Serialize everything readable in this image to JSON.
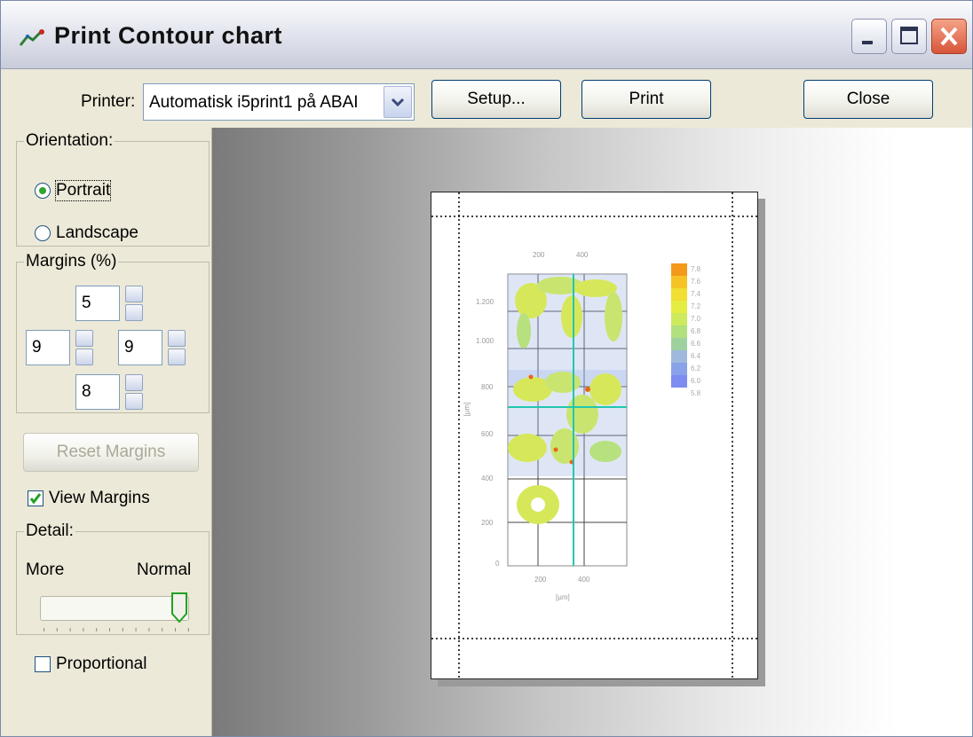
{
  "window": {
    "title": "Print Contour chart"
  },
  "toolbar": {
    "printer_label": "Printer:",
    "printer_value": "Automatisk i5print1 på ABAI",
    "setup_label": "Setup...",
    "print_label": "Print",
    "close_label": "Close"
  },
  "orientation": {
    "legend": "Orientation:",
    "portrait": "Portrait",
    "landscape": "Landscape",
    "selected": "portrait"
  },
  "margins": {
    "legend": "Margins (%)",
    "top": "5",
    "left": "9",
    "right": "9",
    "bottom": "8"
  },
  "reset_margins_label": "Reset Margins",
  "view_margins": {
    "label": "View Margins",
    "checked": true
  },
  "detail": {
    "legend": "Detail:",
    "more_label": "More",
    "normal_label": "Normal"
  },
  "proportional": {
    "label": "Proportional",
    "checked": false
  },
  "preview": {
    "x_ticks": [
      "200",
      "400"
    ],
    "y_ticks": [
      "1.200",
      "1.000",
      "800",
      "600",
      "400",
      "200",
      "0"
    ],
    "x_axis_label": "[µm]",
    "y_axis_label": "[µm]",
    "legend_values": [
      "7.8",
      "7.6",
      "7.4",
      "7.2",
      "7.0",
      "6.8",
      "6.6",
      "6.4",
      "6.2",
      "6.0",
      "5.8"
    ]
  }
}
